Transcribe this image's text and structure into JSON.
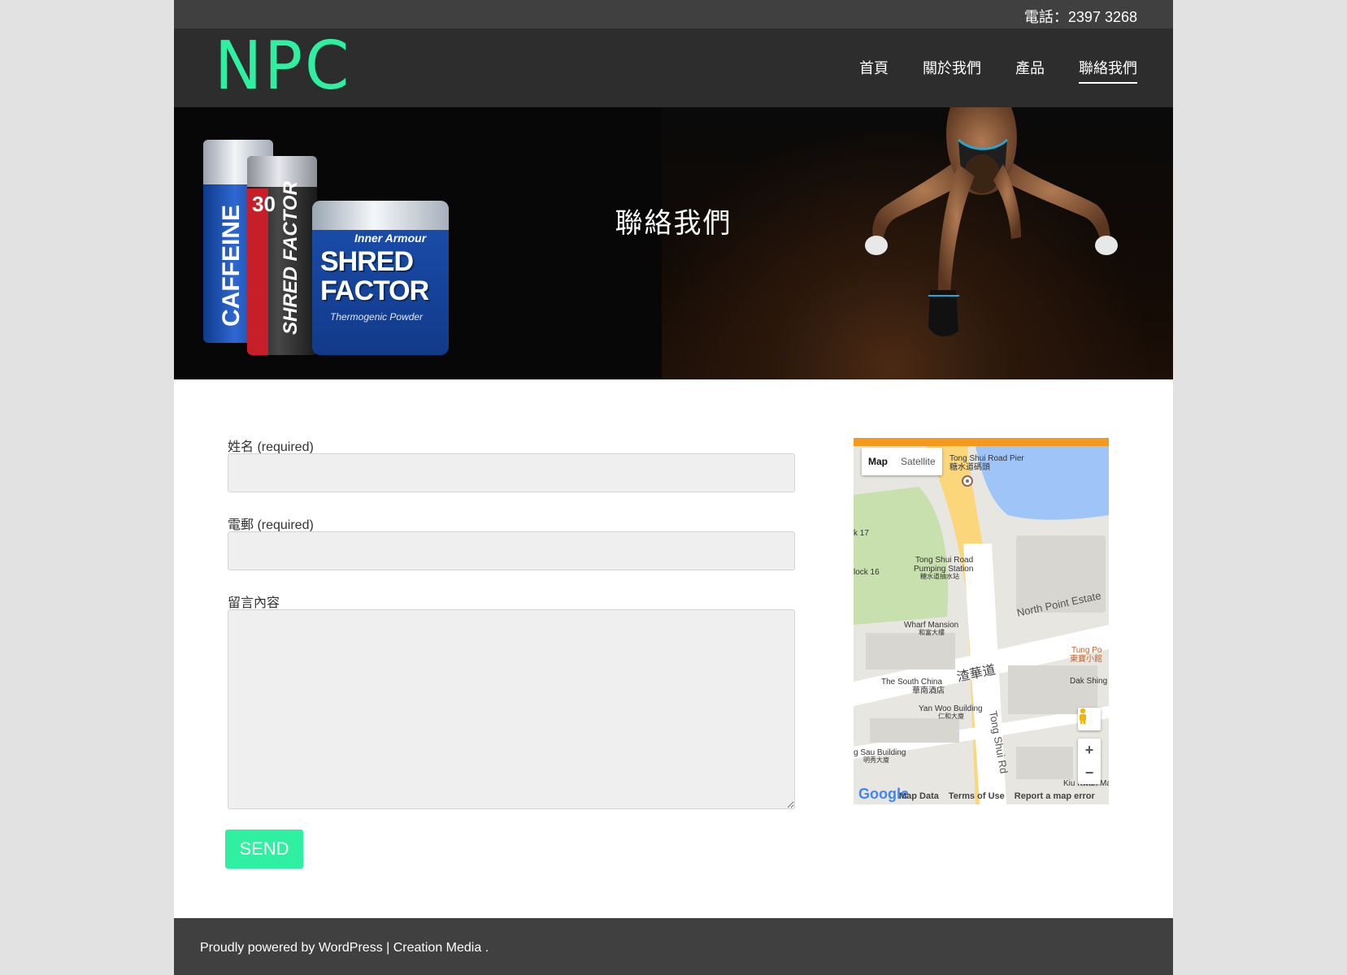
{
  "topbar": {
    "phone": "電話：2397 3268"
  },
  "header": {
    "logo": "NPC",
    "nav": [
      {
        "label": "首頁",
        "active": false
      },
      {
        "label": "關於我們",
        "active": false
      },
      {
        "label": "產品",
        "active": false
      },
      {
        "label": "聯絡我們",
        "active": true
      }
    ]
  },
  "hero": {
    "title": "聯絡我們",
    "products": {
      "can1_label": "CAFFEINE",
      "can2_number": "30",
      "can2_label": "SHRED FACTOR",
      "tub_brand": "Inner Armour",
      "tub_line1": "SHRED",
      "tub_line2": "FACTOR",
      "tub_sub": "Thermogenic Powder"
    }
  },
  "form": {
    "name_label": "姓名 (required)",
    "email_label": "電郵 (required)",
    "message_label": "留言內容",
    "name_value": "",
    "email_value": "",
    "message_value": "",
    "send_label": "SEND"
  },
  "map": {
    "type_map": "Map",
    "type_satellite": "Satellite",
    "labels": {
      "pier": "Tong Shui Road Pier",
      "pier_zh": "糖水道碼頭",
      "pumping": "Tong Shui Road",
      "pumping2": "Pumping Station",
      "pumping_zh": "糖水道抽水站",
      "wharf": "Wharf Mansion",
      "wharf_zh": "和富大樓",
      "north_point": "North Point Estate",
      "tung_po": "Tung Po",
      "tung_po_zh": "東寶小館",
      "south_china": "The South China",
      "south_china_zh": "華南酒店",
      "road_zh": "渣華道",
      "tong_shui_rd": "Tong Shui Rd",
      "dak_shing": "Dak Shing",
      "yan_woo": "Yan Woo Building",
      "yan_woo_zh": "仁和大廈",
      "sau": "g Sau Building",
      "sau_zh": "明秀大廈",
      "kiu_kwan": "Kiu Kwan Ma",
      "block17": "k 17",
      "block16": "lock 16"
    },
    "footer": {
      "map_data": "Map Data",
      "terms": "Terms of Use",
      "report": "Report a map error"
    },
    "google": "Google"
  },
  "footer": {
    "powered": "Proudly powered by WordPress",
    "separator": " | ",
    "creation": "Creation Media",
    "period": " ."
  }
}
